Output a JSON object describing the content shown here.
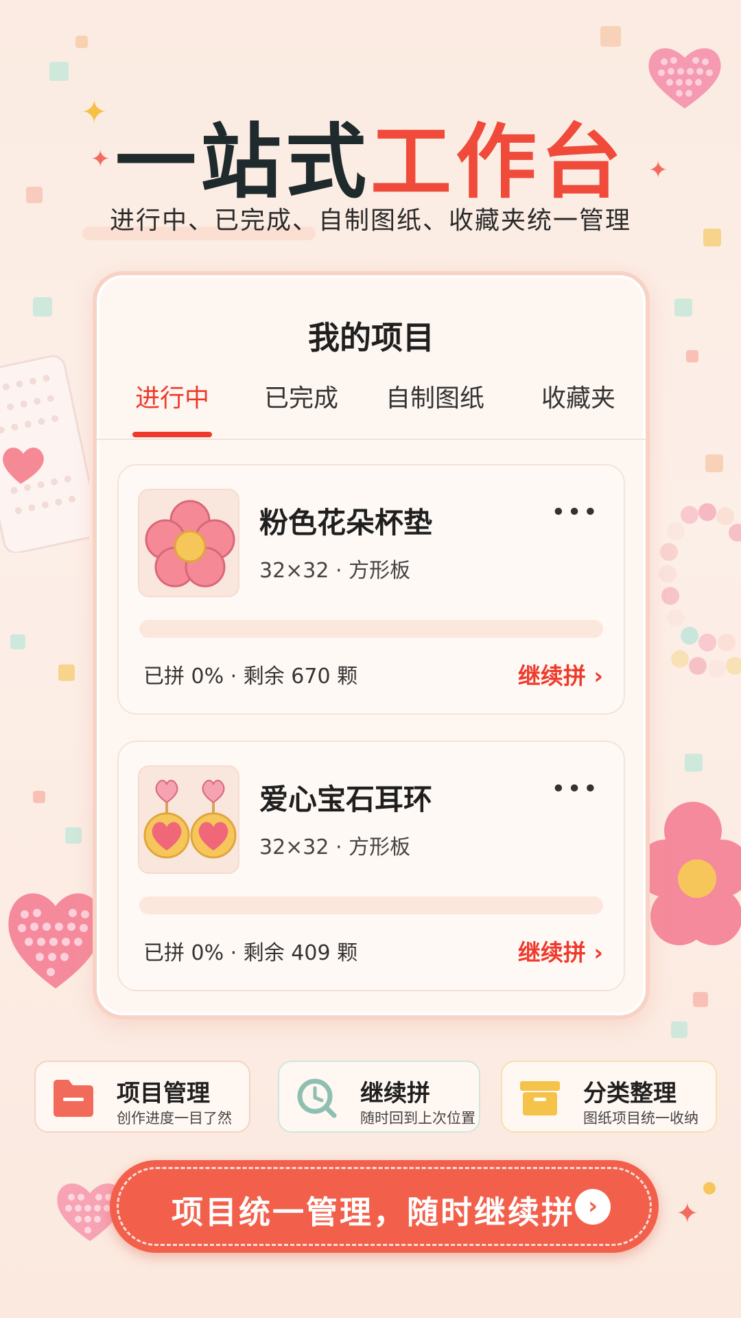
{
  "header": {
    "title_dark": "一站式",
    "title_accent": "工作台",
    "subtitle": "进行中、已完成、自制图纸、收藏夹统一管理"
  },
  "panel": {
    "title": "我的项目",
    "tabs": [
      {
        "label": "进行中",
        "active": true
      },
      {
        "label": "已完成",
        "active": false
      },
      {
        "label": "自制图纸",
        "active": false
      },
      {
        "label": "收藏夹",
        "active": false
      }
    ],
    "items": [
      {
        "title": "粉色花朵杯垫",
        "meta": "32×32 · 方形板",
        "progress": 0,
        "status": "已拼 0% · 剩余 670 颗",
        "action": "继续拼 ›",
        "more_icon": "more-icon",
        "thumb_icon": "pink-flower-icon"
      },
      {
        "title": "爱心宝石耳环",
        "meta": "32×32 · 方形板",
        "progress": 0,
        "status": "已拼 0% · 剩余 409 颗",
        "action": "继续拼 ›",
        "more_icon": "more-icon",
        "thumb_icon": "heart-earrings-icon"
      }
    ]
  },
  "features": [
    {
      "title": "项目管理",
      "desc": "创作进度一目了然",
      "icon": "folder-icon",
      "color": "#f26a5a",
      "border": "#f6d2c4"
    },
    {
      "title": "继续拼",
      "desc": "随时回到上次位置",
      "icon": "clock-search-icon",
      "color": "#8fbfb0",
      "border": "#cfe6dd"
    },
    {
      "title": "分类整理",
      "desc": "图纸项目统一收纳",
      "icon": "archive-box-icon",
      "color": "#f5c24a",
      "border": "#f6e0b0"
    }
  ],
  "cta": {
    "label": "项目统一管理，随时继续拼",
    "icon": "chevron-right-icon"
  },
  "colors": {
    "accent": "#ee3a2c",
    "cta": "#f2604c",
    "background": "#fbebe2"
  }
}
